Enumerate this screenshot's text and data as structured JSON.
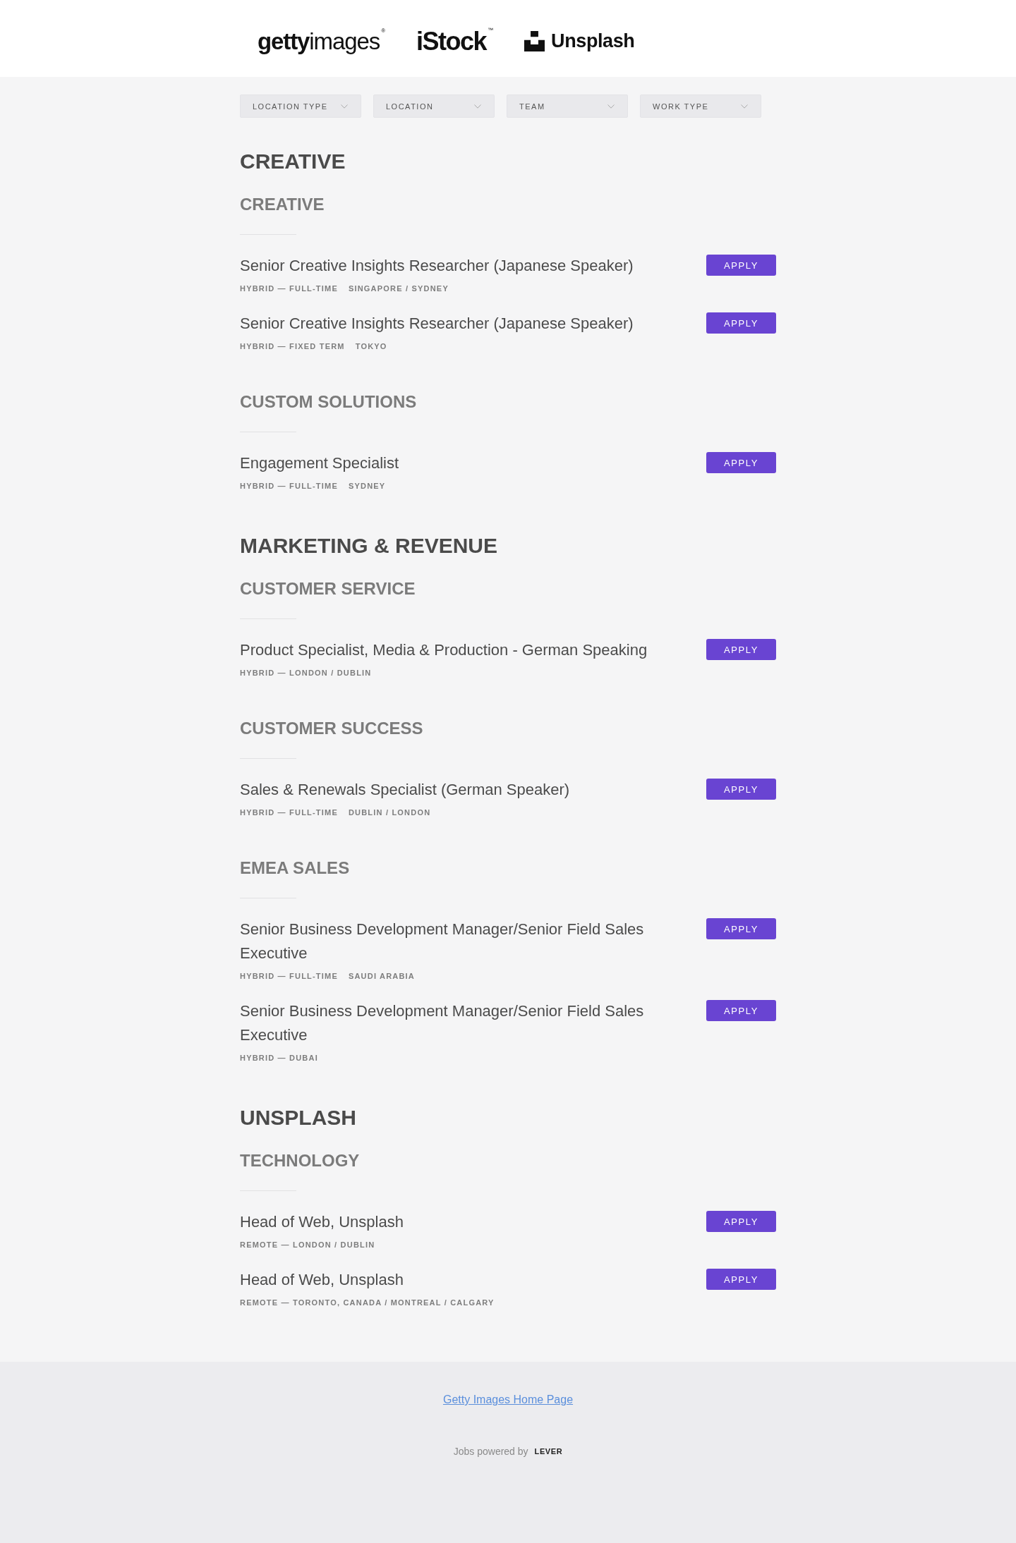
{
  "header": {
    "logos": [
      {
        "kind": "wordmark",
        "text": "**getty**images",
        "mark": "®"
      },
      {
        "kind": "bold_wordmark",
        "text": "iStock",
        "mark": "™"
      },
      {
        "kind": "icon_wordmark",
        "text": "Unsplash"
      }
    ]
  },
  "filters": [
    {
      "label": "LOCATION TYPE"
    },
    {
      "label": "LOCATION"
    },
    {
      "label": "TEAM"
    },
    {
      "label": "WORK TYPE"
    }
  ],
  "departments": [
    {
      "title": "CREATIVE",
      "teams": [
        {
          "title": "CREATIVE",
          "postings": [
            {
              "title": "Senior Creative Insights Researcher (Japanese Speaker)",
              "meta": [
                "HYBRID — FULL-TIME",
                "SINGAPORE / SYDNEY"
              ],
              "action": "APPLY"
            },
            {
              "title": "Senior Creative Insights Researcher (Japanese Speaker)",
              "meta": [
                "HYBRID — FIXED TERM",
                "TOKYO"
              ],
              "action": "APPLY"
            }
          ]
        },
        {
          "title": "CUSTOM SOLUTIONS",
          "postings": [
            {
              "title": "Engagement Specialist",
              "meta": [
                "HYBRID — FULL-TIME",
                "SYDNEY"
              ],
              "action": "APPLY"
            }
          ]
        }
      ]
    },
    {
      "title": "MARKETING & REVENUE",
      "teams": [
        {
          "title": "CUSTOMER SERVICE",
          "postings": [
            {
              "title": "Product Specialist, Media & Production - German Speaking",
              "meta": [
                "HYBRID — LONDON / DUBLIN"
              ],
              "action": "APPLY"
            }
          ]
        },
        {
          "title": "CUSTOMER SUCCESS",
          "postings": [
            {
              "title": "Sales & Renewals Specialist (German Speaker)",
              "meta": [
                "HYBRID — FULL-TIME",
                "DUBLIN / LONDON"
              ],
              "action": "APPLY"
            }
          ]
        },
        {
          "title": "EMEA SALES",
          "postings": [
            {
              "title": "Senior Business Development Manager/Senior Field Sales Executive",
              "meta": [
                "HYBRID — FULL-TIME",
                "SAUDI ARABIA"
              ],
              "action": "APPLY"
            },
            {
              "title": "Senior Business Development Manager/Senior Field Sales Executive",
              "meta": [
                "HYBRID — DUBAI"
              ],
              "action": "APPLY"
            }
          ]
        }
      ]
    },
    {
      "title": "UNSPLASH",
      "teams": [
        {
          "title": "TECHNOLOGY",
          "postings": [
            {
              "title": "Head of Web, Unsplash",
              "meta": [
                "REMOTE — LONDON / DUBLIN"
              ],
              "action": "APPLY"
            },
            {
              "title": "Head of Web, Unsplash",
              "meta": [
                "REMOTE — TORONTO, CANADA / MONTREAL / CALGARY"
              ],
              "action": "APPLY"
            }
          ]
        }
      ]
    }
  ],
  "footer": {
    "link": "Getty Images Home Page",
    "powered_by": "Jobs powered by",
    "vendor": "LEVER"
  }
}
